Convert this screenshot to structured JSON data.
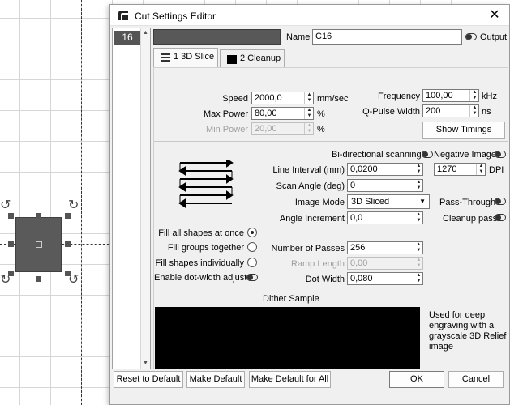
{
  "window": {
    "title": "Cut Settings Editor",
    "close_glyph": "✕"
  },
  "layer": {
    "number": "16",
    "color": "#585858"
  },
  "header": {
    "name_label": "Name",
    "name_value": "C16",
    "output_label": "Output"
  },
  "tabs": [
    {
      "label": "1 3D Slice",
      "icon": "layers-icon"
    },
    {
      "label": "2 Cleanup",
      "icon": "square-icon"
    }
  ],
  "power": {
    "speed_label": "Speed",
    "speed_value": "2000,0",
    "speed_unit": "mm/sec",
    "max_power_label": "Max Power",
    "max_power_value": "80,00",
    "max_power_unit": "%",
    "min_power_label": "Min Power",
    "min_power_value": "20,00",
    "min_power_unit": "%",
    "frequency_label": "Frequency",
    "frequency_value": "100,00",
    "frequency_unit": "kHz",
    "qpulse_label": "Q-Pulse Width",
    "qpulse_value": "200",
    "qpulse_unit": "ns",
    "show_timings_label": "Show Timings"
  },
  "scan": {
    "bidir_label": "Bi-directional scanning",
    "negative_label": "Negative Image",
    "line_interval_label": "Line Interval (mm)",
    "line_interval_value": "0,0200",
    "dpi_value": "1270",
    "dpi_label": "DPI",
    "scan_angle_label": "Scan Angle (deg)",
    "scan_angle_value": "0",
    "image_mode_label": "Image Mode",
    "image_mode_value": "3D Sliced",
    "pass_through_label": "Pass-Through",
    "angle_increment_label": "Angle Increment",
    "angle_increment_value": "0,0",
    "cleanup_pass_label": "Cleanup pass",
    "passes_label": "Number of Passes",
    "passes_value": "256",
    "ramp_length_label": "Ramp Length",
    "ramp_length_value": "0,00",
    "dot_width_label": "Dot Width",
    "dot_width_value": "0,080"
  },
  "fill": {
    "all_label": "Fill all shapes at once",
    "groups_label": "Fill groups together",
    "individual_label": "Fill shapes individually",
    "selected": "all",
    "dot_width_adjust_label": "Enable dot-width adjust"
  },
  "dither": {
    "title": "Dither Sample",
    "description": "Used for deep engraving with a grayscale 3D Relief image"
  },
  "footer": {
    "reset_label": "Reset to Default",
    "make_default_label": "Make Default",
    "make_default_all_label": "Make Default for All",
    "ok_label": "OK",
    "cancel_label": "Cancel"
  }
}
